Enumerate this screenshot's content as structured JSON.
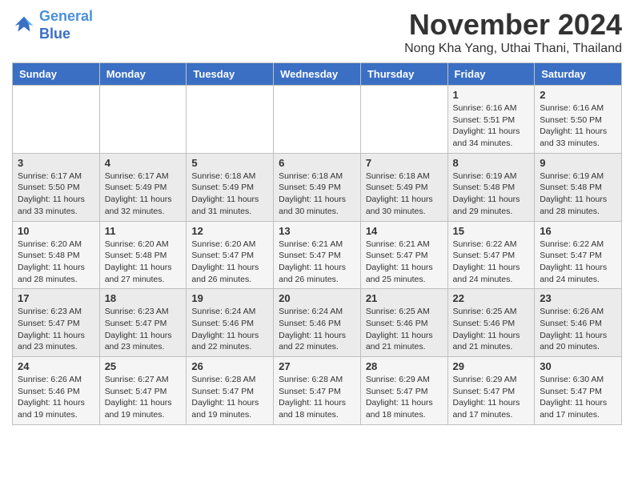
{
  "header": {
    "logo_line1": "General",
    "logo_line2": "Blue",
    "title": "November 2024",
    "location": "Nong Kha Yang, Uthai Thani, Thailand"
  },
  "weekdays": [
    "Sunday",
    "Monday",
    "Tuesday",
    "Wednesday",
    "Thursday",
    "Friday",
    "Saturday"
  ],
  "weeks": [
    [
      {
        "day": "",
        "info": ""
      },
      {
        "day": "",
        "info": ""
      },
      {
        "day": "",
        "info": ""
      },
      {
        "day": "",
        "info": ""
      },
      {
        "day": "",
        "info": ""
      },
      {
        "day": "1",
        "info": "Sunrise: 6:16 AM\nSunset: 5:51 PM\nDaylight: 11 hours and 34 minutes."
      },
      {
        "day": "2",
        "info": "Sunrise: 6:16 AM\nSunset: 5:50 PM\nDaylight: 11 hours and 33 minutes."
      }
    ],
    [
      {
        "day": "3",
        "info": "Sunrise: 6:17 AM\nSunset: 5:50 PM\nDaylight: 11 hours and 33 minutes."
      },
      {
        "day": "4",
        "info": "Sunrise: 6:17 AM\nSunset: 5:49 PM\nDaylight: 11 hours and 32 minutes."
      },
      {
        "day": "5",
        "info": "Sunrise: 6:18 AM\nSunset: 5:49 PM\nDaylight: 11 hours and 31 minutes."
      },
      {
        "day": "6",
        "info": "Sunrise: 6:18 AM\nSunset: 5:49 PM\nDaylight: 11 hours and 30 minutes."
      },
      {
        "day": "7",
        "info": "Sunrise: 6:18 AM\nSunset: 5:49 PM\nDaylight: 11 hours and 30 minutes."
      },
      {
        "day": "8",
        "info": "Sunrise: 6:19 AM\nSunset: 5:48 PM\nDaylight: 11 hours and 29 minutes."
      },
      {
        "day": "9",
        "info": "Sunrise: 6:19 AM\nSunset: 5:48 PM\nDaylight: 11 hours and 28 minutes."
      }
    ],
    [
      {
        "day": "10",
        "info": "Sunrise: 6:20 AM\nSunset: 5:48 PM\nDaylight: 11 hours and 28 minutes."
      },
      {
        "day": "11",
        "info": "Sunrise: 6:20 AM\nSunset: 5:48 PM\nDaylight: 11 hours and 27 minutes."
      },
      {
        "day": "12",
        "info": "Sunrise: 6:20 AM\nSunset: 5:47 PM\nDaylight: 11 hours and 26 minutes."
      },
      {
        "day": "13",
        "info": "Sunrise: 6:21 AM\nSunset: 5:47 PM\nDaylight: 11 hours and 26 minutes."
      },
      {
        "day": "14",
        "info": "Sunrise: 6:21 AM\nSunset: 5:47 PM\nDaylight: 11 hours and 25 minutes."
      },
      {
        "day": "15",
        "info": "Sunrise: 6:22 AM\nSunset: 5:47 PM\nDaylight: 11 hours and 24 minutes."
      },
      {
        "day": "16",
        "info": "Sunrise: 6:22 AM\nSunset: 5:47 PM\nDaylight: 11 hours and 24 minutes."
      }
    ],
    [
      {
        "day": "17",
        "info": "Sunrise: 6:23 AM\nSunset: 5:47 PM\nDaylight: 11 hours and 23 minutes."
      },
      {
        "day": "18",
        "info": "Sunrise: 6:23 AM\nSunset: 5:47 PM\nDaylight: 11 hours and 23 minutes."
      },
      {
        "day": "19",
        "info": "Sunrise: 6:24 AM\nSunset: 5:46 PM\nDaylight: 11 hours and 22 minutes."
      },
      {
        "day": "20",
        "info": "Sunrise: 6:24 AM\nSunset: 5:46 PM\nDaylight: 11 hours and 22 minutes."
      },
      {
        "day": "21",
        "info": "Sunrise: 6:25 AM\nSunset: 5:46 PM\nDaylight: 11 hours and 21 minutes."
      },
      {
        "day": "22",
        "info": "Sunrise: 6:25 AM\nSunset: 5:46 PM\nDaylight: 11 hours and 21 minutes."
      },
      {
        "day": "23",
        "info": "Sunrise: 6:26 AM\nSunset: 5:46 PM\nDaylight: 11 hours and 20 minutes."
      }
    ],
    [
      {
        "day": "24",
        "info": "Sunrise: 6:26 AM\nSunset: 5:46 PM\nDaylight: 11 hours and 19 minutes."
      },
      {
        "day": "25",
        "info": "Sunrise: 6:27 AM\nSunset: 5:47 PM\nDaylight: 11 hours and 19 minutes."
      },
      {
        "day": "26",
        "info": "Sunrise: 6:28 AM\nSunset: 5:47 PM\nDaylight: 11 hours and 19 minutes."
      },
      {
        "day": "27",
        "info": "Sunrise: 6:28 AM\nSunset: 5:47 PM\nDaylight: 11 hours and 18 minutes."
      },
      {
        "day": "28",
        "info": "Sunrise: 6:29 AM\nSunset: 5:47 PM\nDaylight: 11 hours and 18 minutes."
      },
      {
        "day": "29",
        "info": "Sunrise: 6:29 AM\nSunset: 5:47 PM\nDaylight: 11 hours and 17 minutes."
      },
      {
        "day": "30",
        "info": "Sunrise: 6:30 AM\nSunset: 5:47 PM\nDaylight: 11 hours and 17 minutes."
      }
    ]
  ]
}
